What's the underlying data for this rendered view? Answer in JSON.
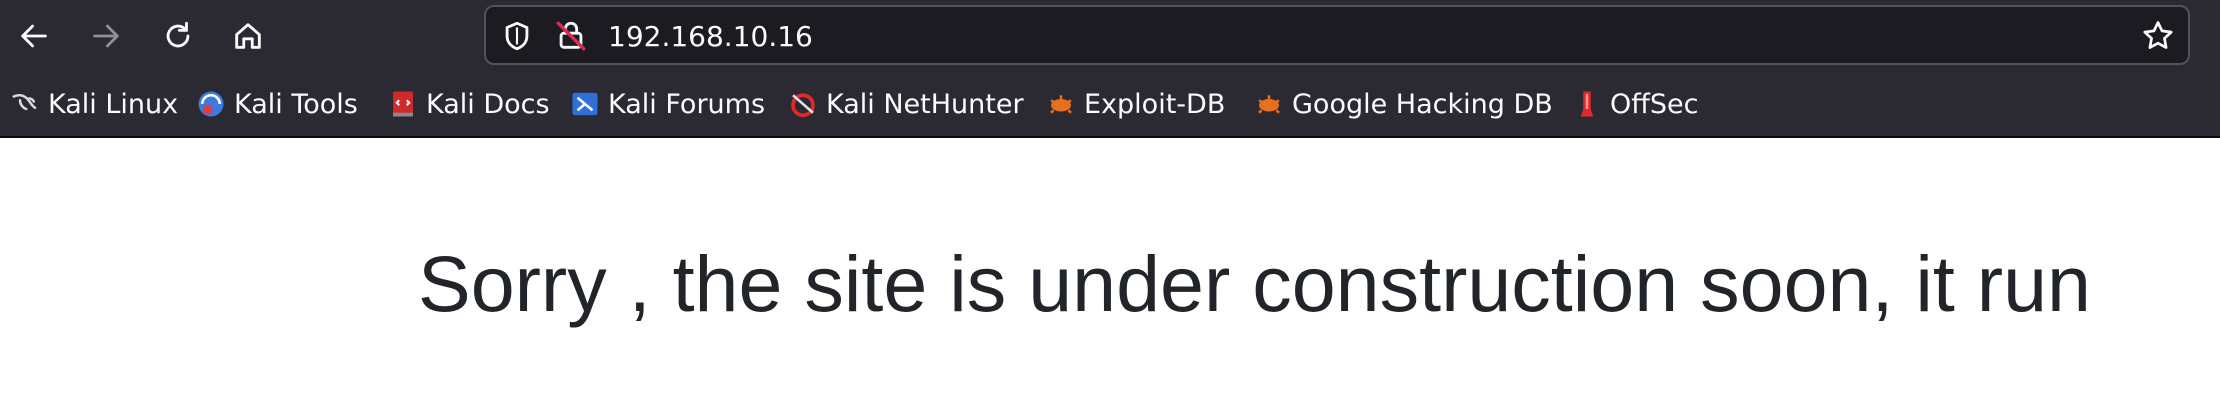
{
  "toolbar": {
    "back_icon": "arrow-left-icon",
    "forward_icon": "arrow-right-icon",
    "reload_icon": "reload-icon",
    "home_icon": "home-icon"
  },
  "urlbar": {
    "url": "192.168.10.16",
    "shield_icon": "shield-icon",
    "lock_icon": "insecure-lock-icon",
    "star_icon": "star-icon"
  },
  "bookmarks": [
    {
      "label": "Kali Linux",
      "icon": "kali-dragon-icon"
    },
    {
      "label": "Kali Tools",
      "icon": "kali-tools-icon"
    },
    {
      "label": "Kali Docs",
      "icon": "kali-docs-icon"
    },
    {
      "label": "Kali Forums",
      "icon": "kali-forums-icon"
    },
    {
      "label": "Kali NetHunter",
      "icon": "kali-nethunter-icon"
    },
    {
      "label": "Exploit-DB",
      "icon": "exploit-db-icon"
    },
    {
      "label": "Google Hacking DB",
      "icon": "ghdb-icon"
    },
    {
      "label": "OffSec",
      "icon": "offsec-icon"
    }
  ],
  "page": {
    "headline": "Sorry , the site is under construction soon, it run"
  },
  "colors": {
    "toolbar_bg": "#2b2a33",
    "urlbar_bg": "#1c1b22",
    "text_light": "#fbfbfe",
    "page_text": "#212529"
  }
}
